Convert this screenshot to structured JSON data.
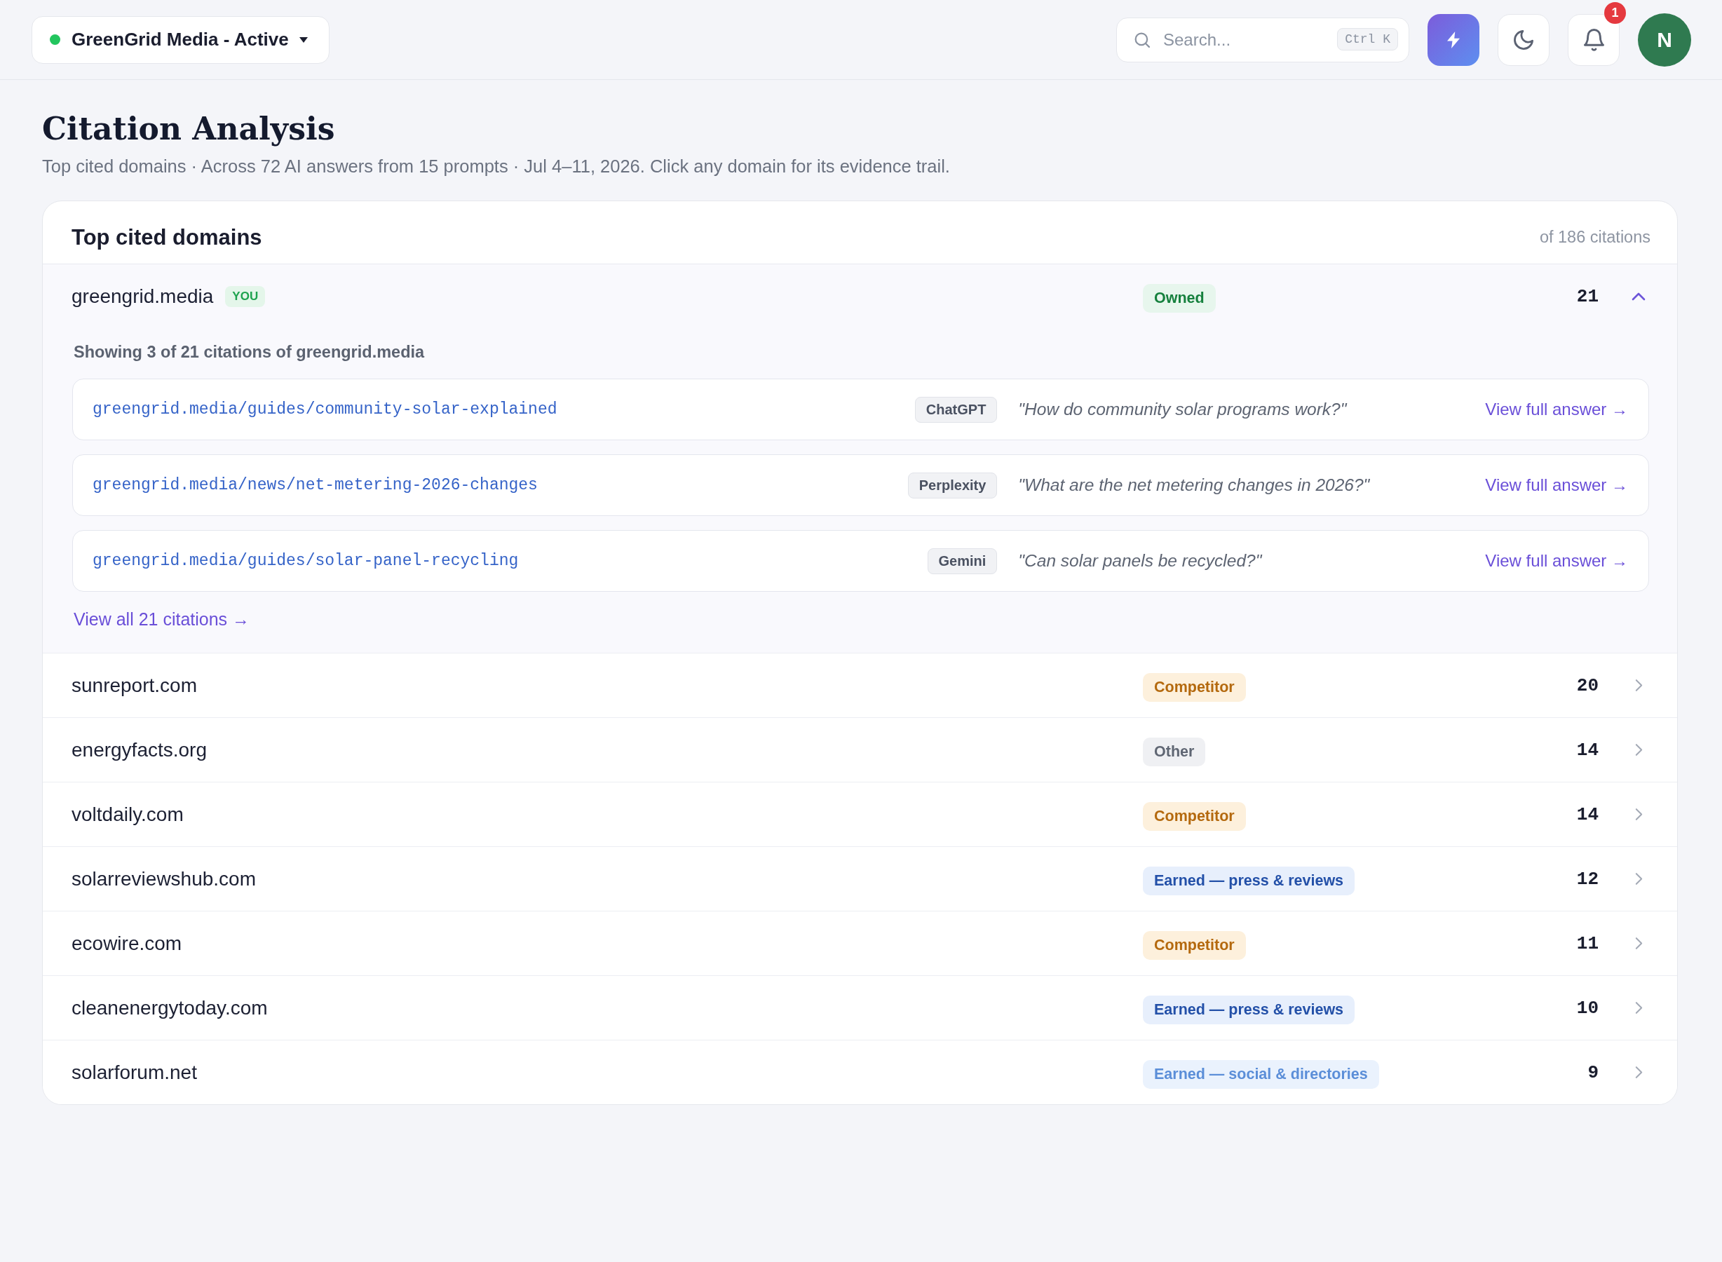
{
  "workspace_selector": {
    "label": "GreenGrid Media - Active"
  },
  "search": {
    "placeholder": "Search...",
    "shortcut": "Ctrl K"
  },
  "notifications": {
    "count": "1"
  },
  "user": {
    "initial": "N"
  },
  "page": {
    "title": "Citation Analysis",
    "subtitle": "Top cited domains · Across 72 AI answers from 15 prompts · Jul 4–11, 2026. Click any domain for its evidence trail."
  },
  "panel": {
    "title": "Top cited domains",
    "total": "of 186 citations",
    "domains": [
      {
        "name": "greengrid.media",
        "tag": "YOU",
        "category": {
          "label": "Owned",
          "kind": "owned"
        },
        "count": "21",
        "expanded": true,
        "details": {
          "summary": "Showing 3 of 21 citations of greengrid.media",
          "citations": [
            {
              "url": "greengrid.media/guides/community-solar-explained",
              "model": "ChatGPT",
              "prompt": "\"How do community solar programs work?\"",
              "link": "View full answer →"
            },
            {
              "url": "greengrid.media/news/net-metering-2026-changes",
              "model": "Perplexity",
              "prompt": "\"What are the net metering changes in 2026?\"",
              "link": "View full answer →"
            },
            {
              "url": "greengrid.media/guides/solar-panel-recycling",
              "model": "Gemini",
              "prompt": "\"Can solar panels be recycled?\"",
              "link": "View full answer →"
            }
          ],
          "view_all": "View all 21 citations →"
        }
      },
      {
        "name": "sunreport.com",
        "category": {
          "label": "Competitor",
          "kind": "competitor"
        },
        "count": "20",
        "expanded": false
      },
      {
        "name": "energyfacts.org",
        "category": {
          "label": "Other",
          "kind": "other"
        },
        "count": "14",
        "expanded": false
      },
      {
        "name": "voltdaily.com",
        "category": {
          "label": "Competitor",
          "kind": "competitor"
        },
        "count": "14",
        "expanded": false
      },
      {
        "name": "solarreviewshub.com",
        "category": {
          "label": "Earned — press & reviews",
          "kind": "earned_press"
        },
        "count": "12",
        "expanded": false
      },
      {
        "name": "ecowire.com",
        "category": {
          "label": "Competitor",
          "kind": "competitor"
        },
        "count": "11",
        "expanded": false
      },
      {
        "name": "cleanenergytoday.com",
        "category": {
          "label": "Earned — press & reviews",
          "kind": "earned_press"
        },
        "count": "10",
        "expanded": false
      },
      {
        "name": "solarforum.net",
        "category": {
          "label": "Earned — social & directories",
          "kind": "earned_social"
        },
        "count": "9",
        "expanded": false
      }
    ]
  }
}
